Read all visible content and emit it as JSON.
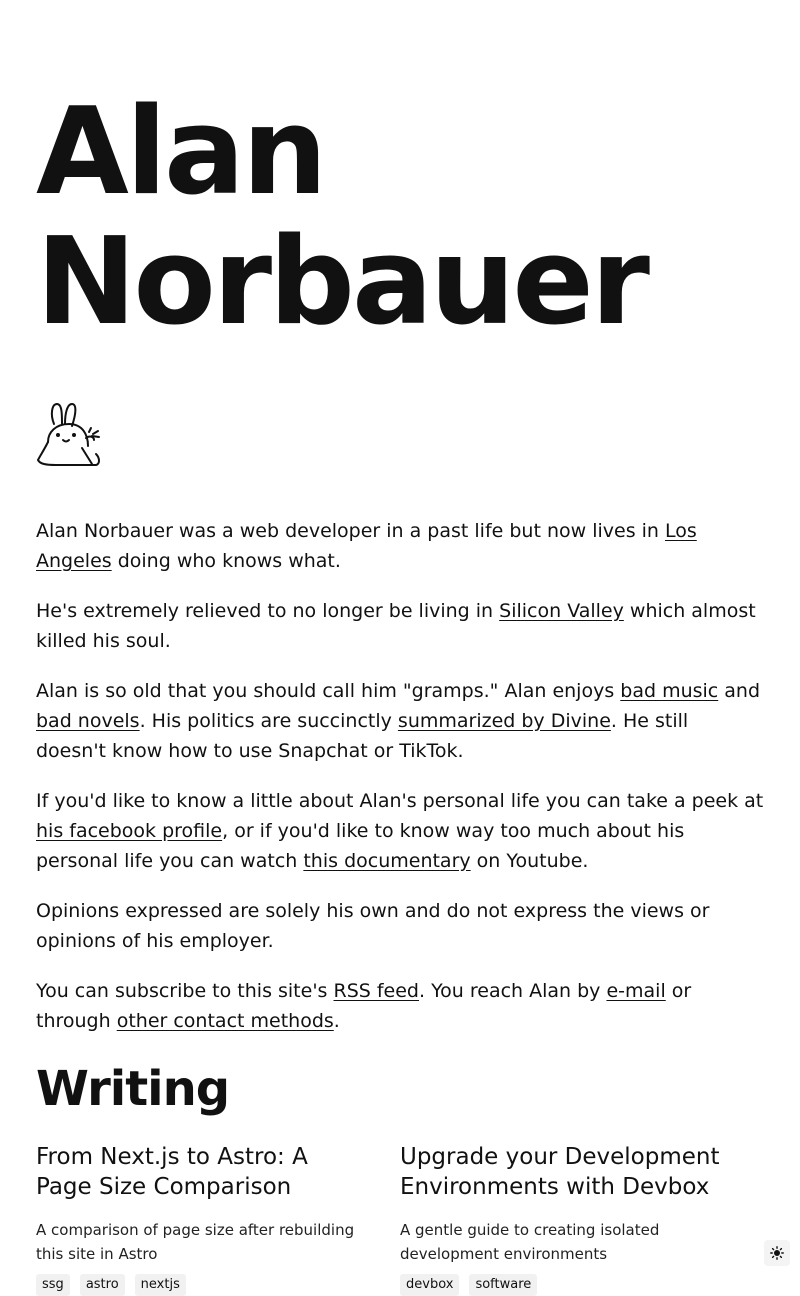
{
  "hero": {
    "line1": "Alan",
    "line2": "Norbauer"
  },
  "bio": {
    "p1": {
      "t1": "Alan Norbauer was a web developer in a past life but now lives in ",
      "link1": "Los Angeles",
      "t2": " doing who knows what."
    },
    "p2": {
      "t1": "He's extremely relieved to no longer be living in ",
      "link1": "Silicon Valley",
      "t2": " which almost killed his soul."
    },
    "p3": {
      "t1": "Alan is so old that you should call him \"gramps.\" Alan enjoys ",
      "link1": "bad music",
      "t2": " and ",
      "link2": "bad novels",
      "t3": ". His politics are succinctly ",
      "link3": "summarized by Divine",
      "t4": ". He still doesn't know how to use Snapchat or TikTok."
    },
    "p4": {
      "t1": "If you'd like to know a little about Alan's personal life you can take a peek at ",
      "link1": "his facebook profile",
      "t2": ", or if you'd like to know way too much about his personal life you can watch ",
      "link2": "this documentary",
      "t3": " on Youtube."
    },
    "p5": {
      "t1": "Opinions expressed are solely his own and do not express the views or opinions of his employer."
    },
    "p6": {
      "t1": "You can subscribe to this site's ",
      "link1": "RSS feed",
      "t2": ". You reach Alan by ",
      "link2": "e-mail",
      "t3": " or through ",
      "link3": "other contact methods",
      "t4": "."
    }
  },
  "writing": {
    "title": "Writing",
    "posts": [
      {
        "title": "From Next.js to Astro: A Page Size Comparison",
        "description": "A comparison of page size after rebuilding this site in Astro",
        "tags": [
          "ssg",
          "astro",
          "nextjs"
        ]
      },
      {
        "title": "Upgrade your Development Environments with Devbox",
        "description": "A gentle guide to creating isolated development environments",
        "tags": [
          "devbox",
          "software"
        ]
      }
    ]
  },
  "icons": {
    "logo": "bunny-with-carrot-icon",
    "theme": "sun-icon"
  }
}
